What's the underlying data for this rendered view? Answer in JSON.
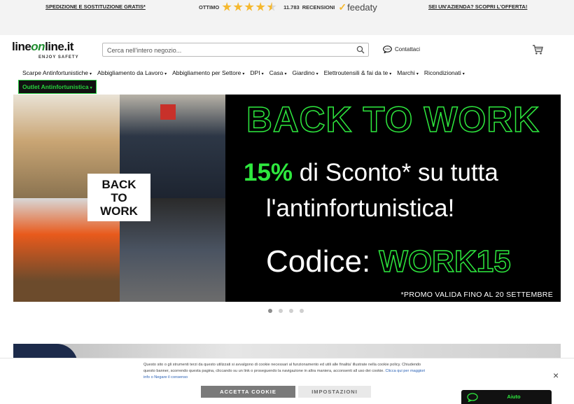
{
  "topbar": {
    "promo_left": "SPEDIZIONE E SOSTITUZIONE GRATIS*",
    "rating_label": "OTTIMO",
    "rating_stars": 4.5,
    "reviews_count": "11.783",
    "reviews_label": "RECENSIONI",
    "feedaty": "feedaty",
    "promo_right": "SEI UN'AZIENDA? SCOPRI L'OFFERTA!"
  },
  "header": {
    "logo_word_1": "line",
    "logo_word_on": "on",
    "logo_word_2": "line.it",
    "logo_tagline": "ENJOY SAFETY",
    "search_placeholder": "Cerca nell'intero negozio...",
    "contact_label": "Contattaci"
  },
  "nav": {
    "items": [
      {
        "label": "Scarpe Antinfortunistiche"
      },
      {
        "label": "Abbigliamento da Lavoro"
      },
      {
        "label": "Abbigliamento per Settore"
      },
      {
        "label": "DPI"
      },
      {
        "label": "Casa"
      },
      {
        "label": "Giardino"
      },
      {
        "label": "Elettroutensili & fai da te"
      },
      {
        "label": "Marchi"
      },
      {
        "label": "Ricondizionati"
      }
    ],
    "outlet_label": "Outlet Antinfortunistica",
    "caret": "▾"
  },
  "banner": {
    "photo_label": "BACK\nTO\nWORK",
    "headline": "BACK TO WORK",
    "discount_pct": "15%",
    "discount_text": " di Sconto* su tutta",
    "line3": "l'antinfortunistica!",
    "code_label": "Codice: ",
    "code_value": "WORK15",
    "note": "*PROMO VALIDA FINO AL 20 SETTEMBRE"
  },
  "carousel": {
    "active_index": 0,
    "count": 4
  },
  "cookie": {
    "text": "Questo sito o gli strumenti terzi da questo utilizzati si avvalgono di cookie necessari al funzionamento ed utili alle finalita' illustrate nella cookie policy. Chiudendo questo banner, scorrendo questa pagina, cliccando su un link o proseguendo la navigazione in altra maniera, acconsenti all uso dei cookie.",
    "link": "Clicca qui per maggiori info o Negare il consenso",
    "accept_label": "ACCETTA COOKIE",
    "settings_label": "IMPOSTAZIONI",
    "close_symbol": "×"
  },
  "help": {
    "label": "Aiuto"
  },
  "colors": {
    "accent_green": "#2ee83e",
    "logo_green": "#1e8c2e",
    "star": "#f5b82e",
    "link_blue": "#2b62b5"
  },
  "icons": [
    "star-icon",
    "feedaty-check-icon",
    "search-icon",
    "chat-icon",
    "cart-icon",
    "close-icon",
    "help-chat-icon"
  ]
}
